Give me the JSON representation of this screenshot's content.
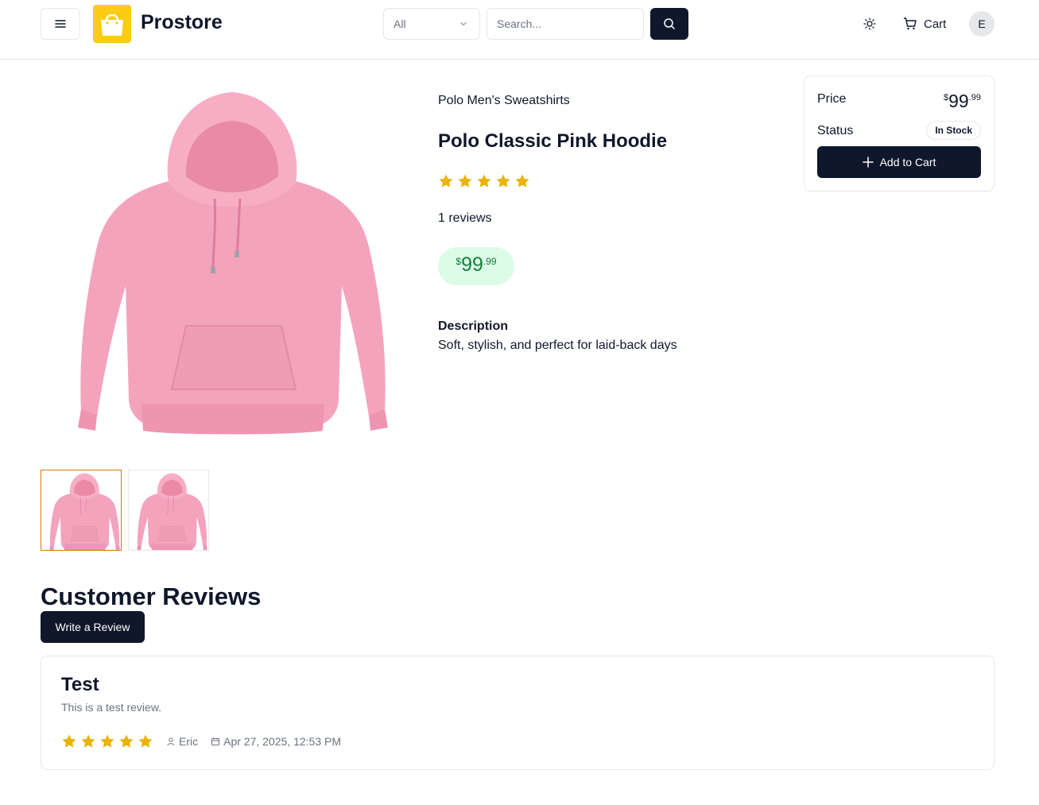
{
  "header": {
    "brand": "Prostore",
    "category_selected": "All",
    "search_placeholder": "Search...",
    "cart_label": "Cart",
    "avatar_initial": "E"
  },
  "product": {
    "category": "Polo Men's Sweatshirts",
    "title": "Polo Classic Pink Hoodie",
    "rating": 5,
    "reviews_text": "1 reviews",
    "price_symbol": "$",
    "price_int": "99",
    "price_dec": ".99",
    "description_label": "Description",
    "description": "Soft, stylish, and perfect for laid-back days"
  },
  "price_card": {
    "price_label": "Price",
    "status_label": "Status",
    "stock": "In Stock",
    "add_to_cart": "Add to Cart"
  },
  "reviews": {
    "heading": "Customer Reviews",
    "write_review": "Write a Review",
    "items": [
      {
        "title": "Test",
        "body": "This is a test review.",
        "rating": 5,
        "author": "Eric",
        "date": "Apr 27, 2025, 12:53 PM"
      }
    ]
  },
  "colors": {
    "primary": "#0f172a",
    "star": "#eab308",
    "price_bg": "#dcfce7",
    "price_text": "#15803d",
    "product_pink": "#f4a3bd",
    "logo_yellow": "#facc15",
    "thumb_active_border": "#d97706"
  },
  "icons": [
    "menu-icon",
    "shopping-bag-icon",
    "chevron-down-icon",
    "search-icon",
    "sun-icon",
    "cart-icon",
    "plus-icon",
    "star-icon",
    "user-icon",
    "calendar-icon"
  ]
}
